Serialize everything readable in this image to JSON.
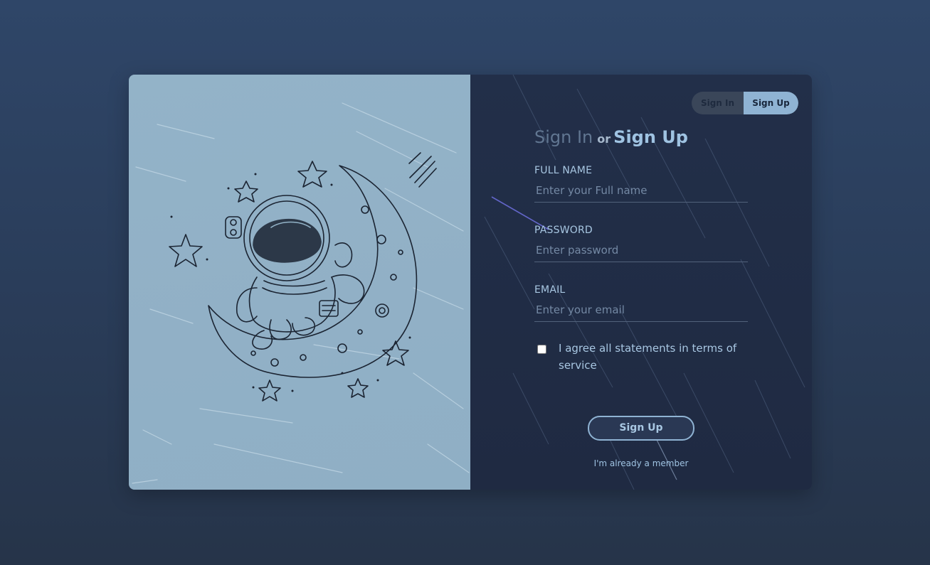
{
  "toggle": {
    "signin_label": "Sign In",
    "signup_label": "Sign Up",
    "active": "Sign Up"
  },
  "heading": {
    "signin": "Sign In",
    "or": "or",
    "signup": "Sign Up"
  },
  "form": {
    "fullname": {
      "label": "FULL NAME",
      "placeholder": "Enter your Full name",
      "value": ""
    },
    "password": {
      "label": "PASSWORD",
      "placeholder": "Enter password",
      "value": ""
    },
    "email": {
      "label": "EMAIL",
      "placeholder": "Enter your email",
      "value": ""
    },
    "terms": {
      "label": "I agree all statements in terms of service",
      "checked": false
    },
    "submit_label": "Sign Up",
    "member_link": "I'm already a member"
  },
  "colors": {
    "accent": "#8fb3d3",
    "panel_dark": "#222f49",
    "panel_light": "#93b3c8",
    "page_bg": "#2f4668"
  },
  "icons": {
    "illustration": "astronaut-on-moon-illustration",
    "checkbox": "checkbox-icon"
  }
}
